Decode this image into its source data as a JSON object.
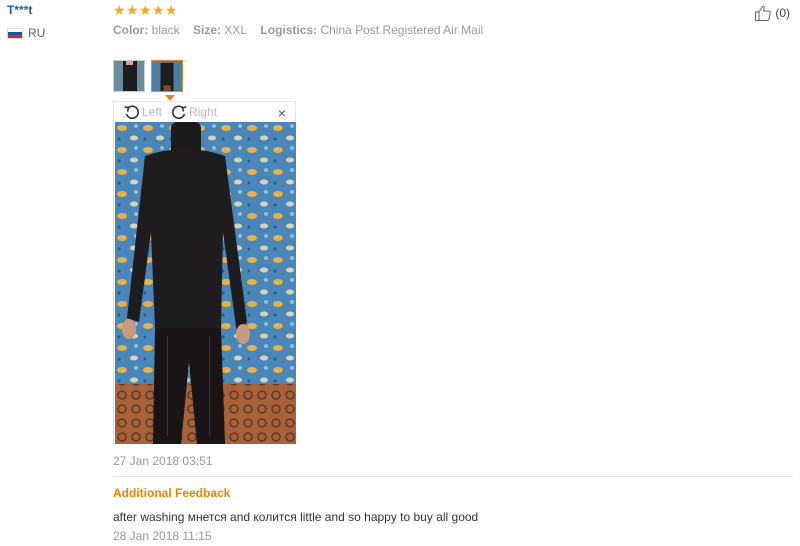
{
  "reviewer": {
    "name": "T***t",
    "country": "RU"
  },
  "rating": {
    "stars": 5,
    "max": 5
  },
  "attributes": [
    {
      "key": "Color:",
      "value": "black"
    },
    {
      "key": "Size:",
      "value": "XXL"
    },
    {
      "key": "Logistics:",
      "value": "China Post Registered Air Mail"
    }
  ],
  "helpful": {
    "count": "(0)"
  },
  "viewer": {
    "rotate_left": "Left",
    "rotate_right": "Right",
    "close": "×",
    "selected_index": 1
  },
  "review_date": "27 Jan 2018 03:51",
  "additional": {
    "title": "Additional Feedback",
    "text": "after washing мнется and колится little and so happy to buy all good",
    "date": "28 Jan 2018 11:15"
  },
  "colors": {
    "link": "#1e5eb0",
    "star": "#f5a623",
    "accent": "#f08200",
    "muted": "#999999"
  }
}
